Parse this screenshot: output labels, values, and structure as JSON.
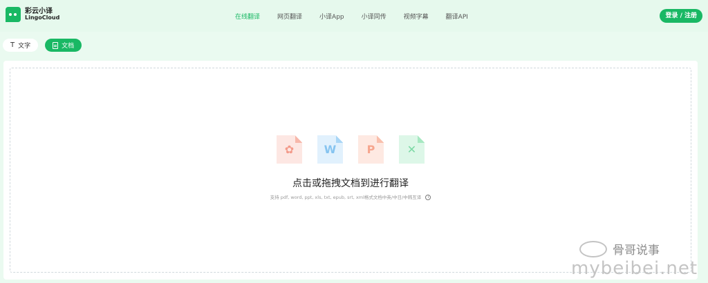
{
  "app": {
    "name_cn": "彩云小译",
    "name_en": "LingoCloud"
  },
  "nav": {
    "items": [
      "在线翻译",
      "网页翻译",
      "小译App",
      "小译同传",
      "视频字幕",
      "翻译API"
    ],
    "active_index": 0
  },
  "header": {
    "login_label": "登录 / 注册"
  },
  "tabs": {
    "text_label": "文字",
    "doc_label": "文档"
  },
  "dropzone": {
    "file_icons": [
      "pdf",
      "word",
      "ppt",
      "xls"
    ],
    "title": "点击或拖拽文档到进行翻译",
    "subtitle": "支持 pdf, word, ppt, xls, txt, epub, srt, xml格式文档中英/中日/中韩互译"
  },
  "watermark": {
    "line1": "骨哥说事",
    "line2": "mybeibei.net"
  },
  "colors": {
    "accent": "#19b864",
    "background": "#eafaf0"
  }
}
